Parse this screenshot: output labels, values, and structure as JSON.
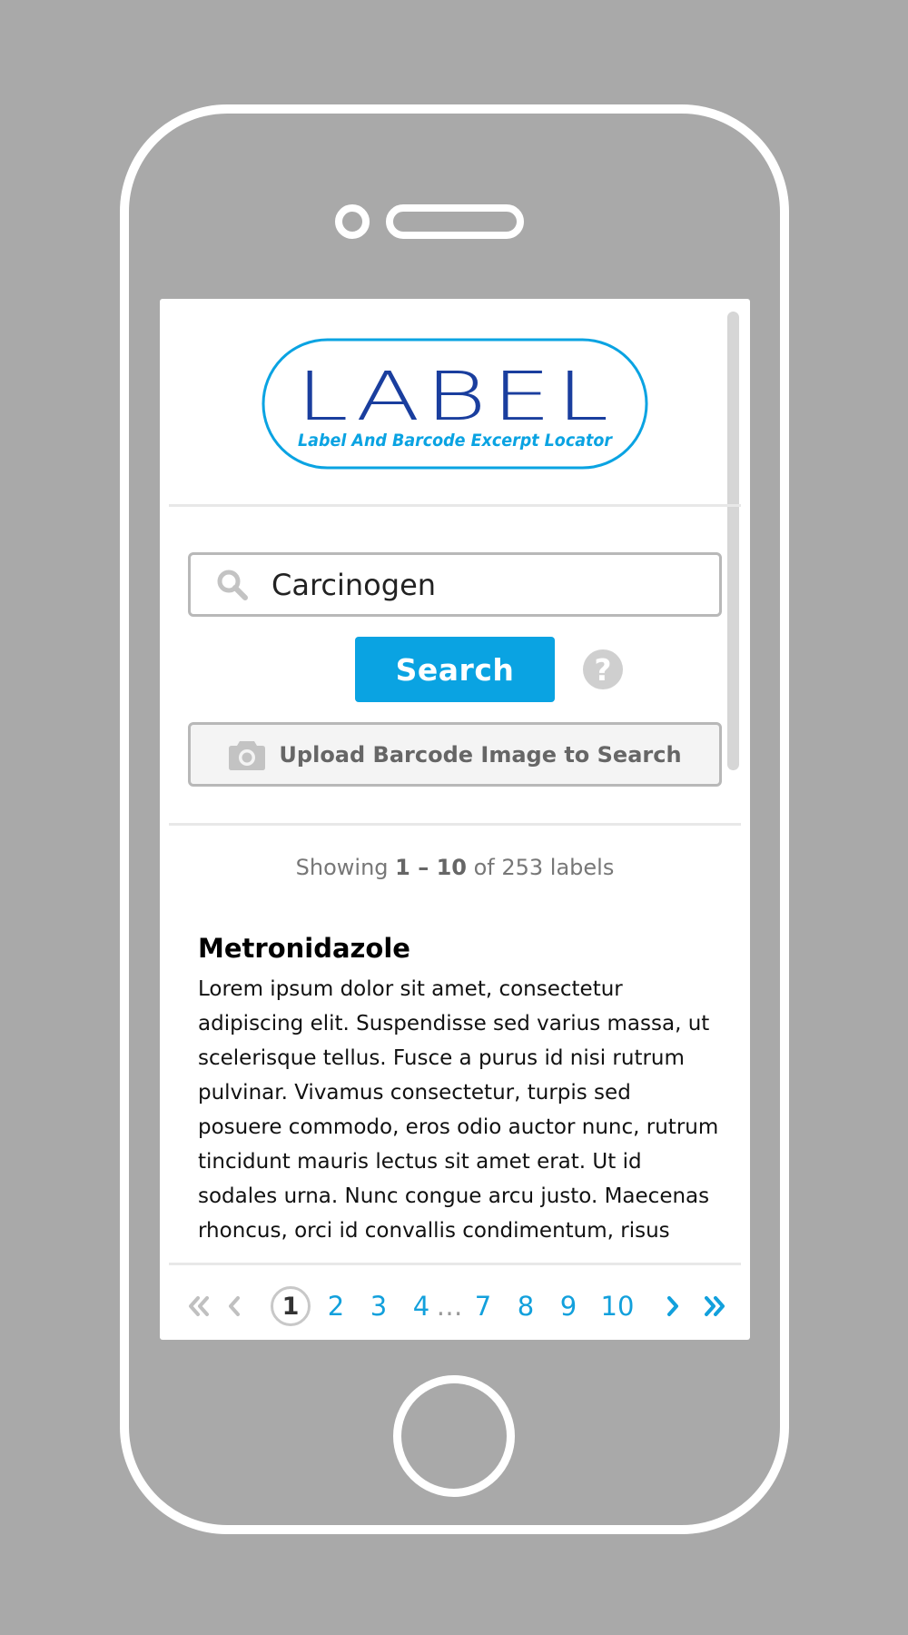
{
  "logo": {
    "title": "LABEL",
    "tagline": "Label And Barcode Excerpt Locator"
  },
  "search": {
    "value": "Carcinogen",
    "button_label": "Search",
    "help_glyph": "?",
    "upload_label": "Upload Barcode Image to Search"
  },
  "results": {
    "showing_prefix": "Showing",
    "showing_range": "1 – 10",
    "showing_suffix": "of 253 labels",
    "items": [
      {
        "title": "Metronidazole",
        "text": "Lorem ipsum dolor sit amet, consectetur adipiscing elit. Suspendisse sed varius massa, ut scelerisque tellus. Fusce a purus id nisi rutrum pulvinar. Vivamus consectetur, turpis sed posuere commodo, eros odio auctor nunc, rutrum tincidunt mauris lectus sit amet erat. Ut id sodales urna. Nunc congue arcu justo. Maecenas rhoncus, orci id convallis condimentum, risus justo vehicula est, eget condimentum nisl fauc"
      }
    ]
  },
  "pagination": {
    "current": "1",
    "pages": [
      "2",
      "3",
      "4",
      "7",
      "8",
      "9",
      "10"
    ],
    "ellipsis": "…"
  },
  "icons": {
    "search": "search-icon",
    "help": "question-mark-icon",
    "camera": "camera-icon",
    "first": "double-chevron-left-icon",
    "prev": "chevron-left-icon",
    "next": "chevron-right-icon",
    "last": "double-chevron-right-icon"
  },
  "colors": {
    "accent": "#0aa3e2",
    "logo_dark": "#1a3e9e",
    "logo_light": "#0aa3e2",
    "background": "#a9a9a9",
    "disabled": "#c0c0c0"
  }
}
